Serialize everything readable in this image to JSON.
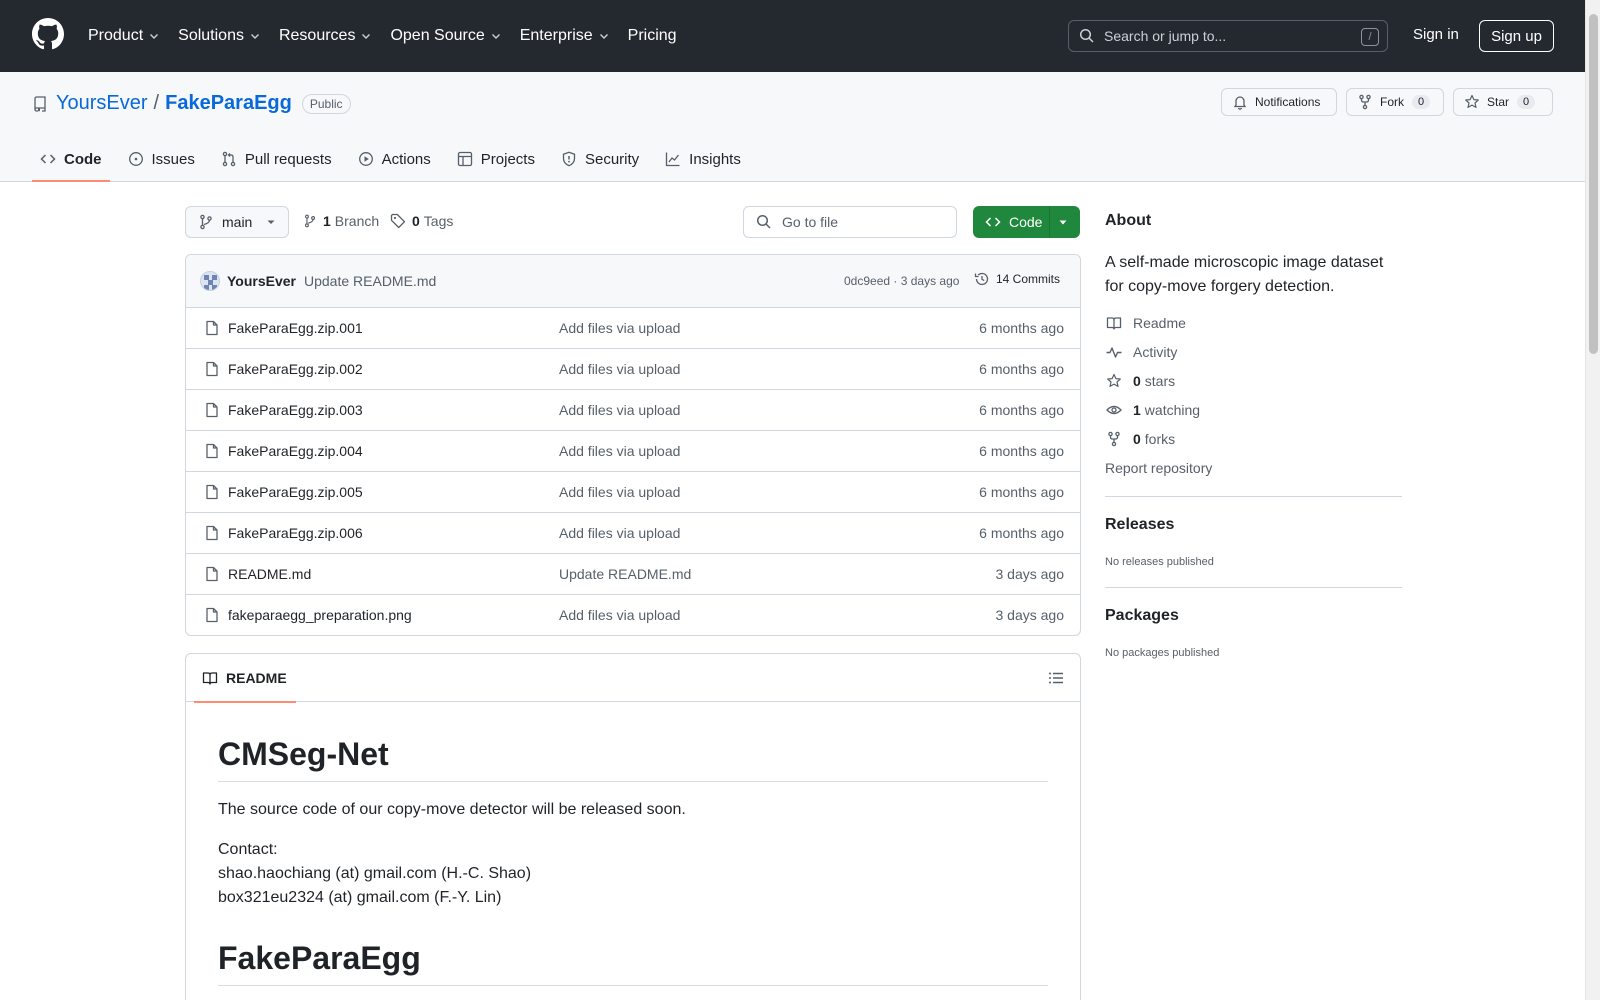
{
  "topnav": {
    "items": [
      {
        "label": "Product",
        "has_menu": true
      },
      {
        "label": "Solutions",
        "has_menu": true
      },
      {
        "label": "Resources",
        "has_menu": true
      },
      {
        "label": "Open Source",
        "has_menu": true
      },
      {
        "label": "Enterprise",
        "has_menu": true
      },
      {
        "label": "Pricing",
        "has_menu": false
      }
    ],
    "search_placeholder": "Search or jump to...",
    "search_shortcut": "/",
    "signin_label": "Sign in",
    "signup_label": "Sign up"
  },
  "repo": {
    "owner": "YoursEver",
    "separator": "/",
    "name": "FakeParaEgg",
    "visibility": "Public",
    "notifications_label": "Notifications",
    "fork_label": "Fork",
    "fork_count": "0",
    "star_label": "Star",
    "star_count": "0"
  },
  "tabs": [
    {
      "label": "Code",
      "icon": "code-icon",
      "active": true
    },
    {
      "label": "Issues",
      "icon": "issue-icon",
      "active": false
    },
    {
      "label": "Pull requests",
      "icon": "pull-request-icon",
      "active": false
    },
    {
      "label": "Actions",
      "icon": "play-icon",
      "active": false
    },
    {
      "label": "Projects",
      "icon": "table-icon",
      "active": false
    },
    {
      "label": "Security",
      "icon": "shield-icon",
      "active": false
    },
    {
      "label": "Insights",
      "icon": "graph-icon",
      "active": false
    }
  ],
  "toolbar": {
    "branch": "main",
    "branch_count": "1",
    "branch_label": "Branch",
    "tag_count": "0",
    "tag_label": "Tags",
    "goto_placeholder": "Go to file",
    "code_button": "Code"
  },
  "latest_commit": {
    "author": "YoursEver",
    "message": "Update README.md",
    "hash_and_age": "0dc9eed · 3 days ago",
    "commits_label": "14 Commits"
  },
  "files": [
    {
      "name": "FakeParaEgg.zip.001",
      "message": "Add files via upload",
      "age": "6 months ago"
    },
    {
      "name": "FakeParaEgg.zip.002",
      "message": "Add files via upload",
      "age": "6 months ago"
    },
    {
      "name": "FakeParaEgg.zip.003",
      "message": "Add files via upload",
      "age": "6 months ago"
    },
    {
      "name": "FakeParaEgg.zip.004",
      "message": "Add files via upload",
      "age": "6 months ago"
    },
    {
      "name": "FakeParaEgg.zip.005",
      "message": "Add files via upload",
      "age": "6 months ago"
    },
    {
      "name": "FakeParaEgg.zip.006",
      "message": "Add files via upload",
      "age": "6 months ago"
    },
    {
      "name": "README.md",
      "message": "Update README.md",
      "age": "3 days ago"
    },
    {
      "name": "fakeparaegg_preparation.png",
      "message": "Add files via upload",
      "age": "3 days ago"
    }
  ],
  "readme": {
    "tab_label": "README",
    "heading1": "CMSeg-Net",
    "paragraph1": "The source code of our copy-move detector will be released soon.",
    "contact_label": "Contact:",
    "contact1": "shao.haochiang (at) gmail.com (H.-C. Shao)",
    "contact2": "box321eu2324 (at) gmail.com (F.-Y. Lin)",
    "heading2": "FakeParaEgg"
  },
  "sidebar": {
    "about_title": "About",
    "description": "A self-made microscopic image dataset for copy-move forgery detection.",
    "readme_label": "Readme",
    "activity_label": "Activity",
    "stars_count": "0",
    "stars_label": "stars",
    "watching_count": "1",
    "watching_label": "watching",
    "forks_count": "0",
    "forks_label": "forks",
    "report_label": "Report repository",
    "releases_title": "Releases",
    "releases_empty": "No releases published",
    "packages_title": "Packages",
    "packages_empty": "No packages published"
  },
  "colors": {
    "header_bg": "#24292f",
    "link": "#0969da",
    "code_button": "#1f883d",
    "active_tab_underline": "#fd8c73"
  }
}
